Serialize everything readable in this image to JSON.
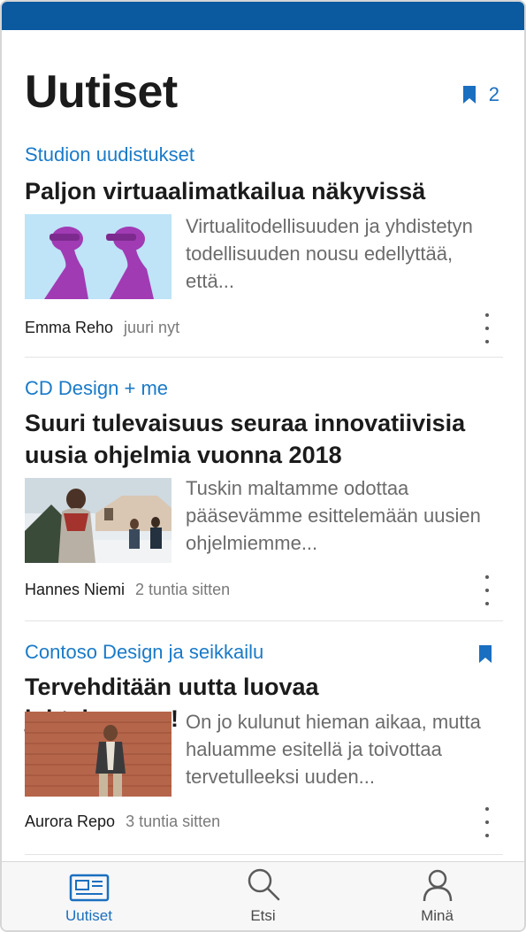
{
  "header": {
    "title": "Uutiset",
    "saved_count": "2",
    "saved_icon": "bookmark-icon"
  },
  "articles": [
    {
      "source": "Studion uudistukset",
      "headline": "Paljon virtuaalimatkailua näkyvissä",
      "excerpt": "Virtualitodellisuuden ja yhdistetyn todellisuuden nousu edellyttää, että...",
      "author": "Emma Reho",
      "time": "juuri nyt",
      "bookmarked": false
    },
    {
      "source": "CD Design + me",
      "headline": "Suuri tulevaisuus seuraa innovatiivisia uusia ohjelmia vuonna 2018",
      "excerpt": "Tuskin maltamme odottaa pääsevämme esittelemään uusien ohjelmiemme...",
      "author": "Hannes Niemi",
      "time": "2 tuntia sitten",
      "bookmarked": false
    },
    {
      "source": "Contoso Design ja seikkailu",
      "headline": "Tervehditään uutta luovaa johtajaamme!",
      "excerpt": "On jo kulunut hieman aikaa, mutta haluamme esitellä ja toivottaa tervetulleeksi uuden...",
      "author": "Aurora Repo",
      "time": "3 tuntia sitten",
      "bookmarked": true
    }
  ],
  "tabs": [
    {
      "label": "Uutiset",
      "icon": "news-icon",
      "active": true
    },
    {
      "label": "Etsi",
      "icon": "search-icon",
      "active": false
    },
    {
      "label": "Minä",
      "icon": "person-icon",
      "active": false
    }
  ],
  "colors": {
    "accent": "#1a6fc0",
    "top_bar": "#0b5aa0",
    "source_link": "#1a7ac8"
  }
}
